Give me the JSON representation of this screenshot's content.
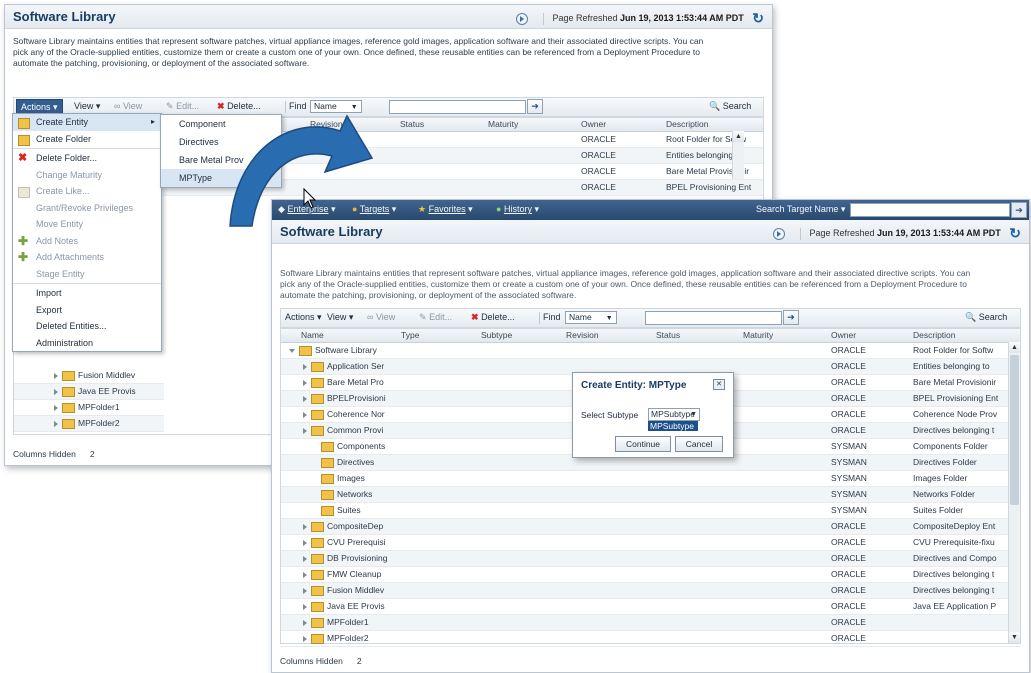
{
  "back": {
    "title": "Software Library",
    "refresh_label": "Page Refreshed",
    "refresh_time": "Jun 19, 2013 1:53:44 AM PDT",
    "desc1": "Software Library maintains entities that represent software patches, virtual appliance images, reference gold images, application software and their associated directive scripts. You can",
    "desc2": "pick any of the Oracle-supplied entities, customize them or create a custom one of your own. Once defined, these reusable entities can be referenced from a Deployment Procedure to",
    "desc3": "automate the patching, provisioning, or deployment of the associated software.",
    "toolbar": {
      "actions": "Actions",
      "view": "View",
      "view2": "View",
      "edit": "Edit...",
      "delete": "Delete...",
      "find": "Find",
      "find_field": "Name",
      "search": "Search"
    },
    "cols": [
      "Revision",
      "Status",
      "Maturity",
      "Owner",
      "Description"
    ],
    "rows": [
      {
        "owner": "ORACLE",
        "desc": "Root Folder for Softw"
      },
      {
        "owner": "ORACLE",
        "desc": "Entities belonging to"
      },
      {
        "owner": "ORACLE",
        "desc": "Bare Metal Provisionir"
      },
      {
        "owner": "ORACLE",
        "desc": "BPEL Provisioning Ent"
      }
    ],
    "tree": [
      "Fusion Middlev",
      "Java EE Provis",
      "MPFolder1",
      "MPFolder2"
    ],
    "footer_label": "Columns Hidden",
    "footer_count": "2"
  },
  "actions_menu": [
    {
      "label": "Create Entity",
      "icon": "create-entity-icon",
      "submenu": true
    },
    {
      "label": "Create Folder",
      "icon": "create-folder-icon"
    },
    {
      "sep": true
    },
    {
      "label": "Delete Folder...",
      "icon": "delete-icon"
    },
    {
      "label": "Change Maturity",
      "dim": true
    },
    {
      "label": "Create Like...",
      "icon": "create-like-icon",
      "dim": true
    },
    {
      "label": "Grant/Revoke Privileges",
      "dim": true
    },
    {
      "label": "Move Entity",
      "dim": true
    },
    {
      "label": "Add Notes",
      "icon": "add-notes-icon",
      "dim": true
    },
    {
      "label": "Add Attachments",
      "icon": "add-attachments-icon",
      "dim": true
    },
    {
      "label": "Stage Entity",
      "dim": true
    },
    {
      "sep": true
    },
    {
      "label": "Import"
    },
    {
      "label": "Export"
    },
    {
      "label": "Deleted Entities..."
    },
    {
      "label": "Administration"
    }
  ],
  "submenu": [
    "Component",
    "Directives",
    "Bare Metal Prov",
    "MPType"
  ],
  "front": {
    "nav": {
      "enterprise": "Enterprise",
      "targets": "Targets",
      "favorites": "Favorites",
      "history": "History",
      "search_label": "Search Target Name"
    },
    "title": "Software Library",
    "cols": [
      "Name",
      "Type",
      "Subtype",
      "Revision",
      "Status",
      "Maturity",
      "Owner",
      "Description"
    ],
    "rows": [
      {
        "name": "Software Library",
        "level": 0,
        "open": true,
        "owner": "ORACLE",
        "desc": "Root Folder for Softw"
      },
      {
        "name": "Application Ser",
        "level": 1,
        "owner": "ORACLE",
        "desc": "Entities belonging to"
      },
      {
        "name": "Bare Metal Pro",
        "level": 1,
        "owner": "ORACLE",
        "desc": "Bare Metal Provisionir"
      },
      {
        "name": "BPELProvisioni",
        "level": 1,
        "owner": "ORACLE",
        "desc": "BPEL Provisioning Ent"
      },
      {
        "name": "Coherence Nor",
        "level": 1,
        "owner": "ORACLE",
        "desc": "Coherence Node Prov"
      },
      {
        "name": "Common Provi",
        "level": 1,
        "owner": "ORACLE",
        "desc": "Directives belonging t"
      },
      {
        "name": "Components",
        "level": 2,
        "owner": "SYSMAN",
        "desc": "Components Folder"
      },
      {
        "name": "Directives",
        "level": 2,
        "owner": "SYSMAN",
        "desc": "Directives Folder"
      },
      {
        "name": "Images",
        "level": 2,
        "owner": "SYSMAN",
        "desc": "Images Folder"
      },
      {
        "name": "Networks",
        "level": 2,
        "owner": "SYSMAN",
        "desc": "Networks Folder"
      },
      {
        "name": "Suites",
        "level": 2,
        "owner": "SYSMAN",
        "desc": "Suites Folder"
      },
      {
        "name": "CompositeDep",
        "level": 1,
        "owner": "ORACLE",
        "desc": "CompositeDeploy Ent"
      },
      {
        "name": "CVU Prerequisi",
        "level": 1,
        "owner": "ORACLE",
        "desc": "CVU Prerequisite-fixu"
      },
      {
        "name": "DB Provisioning",
        "level": 1,
        "owner": "ORACLE",
        "desc": "Directives and Compo"
      },
      {
        "name": "FMW Cleanup",
        "level": 1,
        "owner": "ORACLE",
        "desc": "Directives belonging t"
      },
      {
        "name": "Fusion Middlev",
        "level": 1,
        "owner": "ORACLE",
        "desc": "Directives belonging t"
      },
      {
        "name": "Java EE Provis",
        "level": 1,
        "owner": "ORACLE",
        "desc": "Java EE Application P"
      },
      {
        "name": "MPFolder1",
        "level": 1,
        "owner": "ORACLE",
        "desc": ""
      },
      {
        "name": "MPFolder2",
        "level": 1,
        "owner": "ORACLE",
        "desc": ""
      }
    ],
    "dialog": {
      "title": "Create Entity: MPType",
      "label": "Select Subtype",
      "value": "MPSubtype",
      "option": "MPSubtype",
      "continue": "Continue",
      "cancel": "Cancel"
    },
    "footer_label": "Columns Hidden",
    "footer_count": "2"
  },
  "colors": {
    "accent": "#345e90",
    "nav": "#27496f",
    "arrow": "#2a6cb0"
  }
}
